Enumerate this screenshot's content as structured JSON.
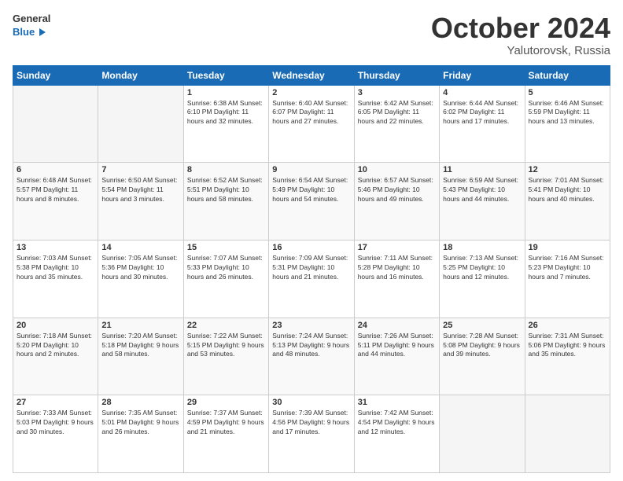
{
  "header": {
    "logo_line1": "General",
    "logo_line2": "Blue",
    "month": "October 2024",
    "location": "Yalutorovsk, Russia"
  },
  "weekdays": [
    "Sunday",
    "Monday",
    "Tuesday",
    "Wednesday",
    "Thursday",
    "Friday",
    "Saturday"
  ],
  "weeks": [
    [
      {
        "day": "",
        "info": ""
      },
      {
        "day": "",
        "info": ""
      },
      {
        "day": "1",
        "info": "Sunrise: 6:38 AM\nSunset: 6:10 PM\nDaylight: 11 hours\nand 32 minutes."
      },
      {
        "day": "2",
        "info": "Sunrise: 6:40 AM\nSunset: 6:07 PM\nDaylight: 11 hours\nand 27 minutes."
      },
      {
        "day": "3",
        "info": "Sunrise: 6:42 AM\nSunset: 6:05 PM\nDaylight: 11 hours\nand 22 minutes."
      },
      {
        "day": "4",
        "info": "Sunrise: 6:44 AM\nSunset: 6:02 PM\nDaylight: 11 hours\nand 17 minutes."
      },
      {
        "day": "5",
        "info": "Sunrise: 6:46 AM\nSunset: 5:59 PM\nDaylight: 11 hours\nand 13 minutes."
      }
    ],
    [
      {
        "day": "6",
        "info": "Sunrise: 6:48 AM\nSunset: 5:57 PM\nDaylight: 11 hours\nand 8 minutes."
      },
      {
        "day": "7",
        "info": "Sunrise: 6:50 AM\nSunset: 5:54 PM\nDaylight: 11 hours\nand 3 minutes."
      },
      {
        "day": "8",
        "info": "Sunrise: 6:52 AM\nSunset: 5:51 PM\nDaylight: 10 hours\nand 58 minutes."
      },
      {
        "day": "9",
        "info": "Sunrise: 6:54 AM\nSunset: 5:49 PM\nDaylight: 10 hours\nand 54 minutes."
      },
      {
        "day": "10",
        "info": "Sunrise: 6:57 AM\nSunset: 5:46 PM\nDaylight: 10 hours\nand 49 minutes."
      },
      {
        "day": "11",
        "info": "Sunrise: 6:59 AM\nSunset: 5:43 PM\nDaylight: 10 hours\nand 44 minutes."
      },
      {
        "day": "12",
        "info": "Sunrise: 7:01 AM\nSunset: 5:41 PM\nDaylight: 10 hours\nand 40 minutes."
      }
    ],
    [
      {
        "day": "13",
        "info": "Sunrise: 7:03 AM\nSunset: 5:38 PM\nDaylight: 10 hours\nand 35 minutes."
      },
      {
        "day": "14",
        "info": "Sunrise: 7:05 AM\nSunset: 5:36 PM\nDaylight: 10 hours\nand 30 minutes."
      },
      {
        "day": "15",
        "info": "Sunrise: 7:07 AM\nSunset: 5:33 PM\nDaylight: 10 hours\nand 26 minutes."
      },
      {
        "day": "16",
        "info": "Sunrise: 7:09 AM\nSunset: 5:31 PM\nDaylight: 10 hours\nand 21 minutes."
      },
      {
        "day": "17",
        "info": "Sunrise: 7:11 AM\nSunset: 5:28 PM\nDaylight: 10 hours\nand 16 minutes."
      },
      {
        "day": "18",
        "info": "Sunrise: 7:13 AM\nSunset: 5:25 PM\nDaylight: 10 hours\nand 12 minutes."
      },
      {
        "day": "19",
        "info": "Sunrise: 7:16 AM\nSunset: 5:23 PM\nDaylight: 10 hours\nand 7 minutes."
      }
    ],
    [
      {
        "day": "20",
        "info": "Sunrise: 7:18 AM\nSunset: 5:20 PM\nDaylight: 10 hours\nand 2 minutes."
      },
      {
        "day": "21",
        "info": "Sunrise: 7:20 AM\nSunset: 5:18 PM\nDaylight: 9 hours\nand 58 minutes."
      },
      {
        "day": "22",
        "info": "Sunrise: 7:22 AM\nSunset: 5:15 PM\nDaylight: 9 hours\nand 53 minutes."
      },
      {
        "day": "23",
        "info": "Sunrise: 7:24 AM\nSunset: 5:13 PM\nDaylight: 9 hours\nand 48 minutes."
      },
      {
        "day": "24",
        "info": "Sunrise: 7:26 AM\nSunset: 5:11 PM\nDaylight: 9 hours\nand 44 minutes."
      },
      {
        "day": "25",
        "info": "Sunrise: 7:28 AM\nSunset: 5:08 PM\nDaylight: 9 hours\nand 39 minutes."
      },
      {
        "day": "26",
        "info": "Sunrise: 7:31 AM\nSunset: 5:06 PM\nDaylight: 9 hours\nand 35 minutes."
      }
    ],
    [
      {
        "day": "27",
        "info": "Sunrise: 7:33 AM\nSunset: 5:03 PM\nDaylight: 9 hours\nand 30 minutes."
      },
      {
        "day": "28",
        "info": "Sunrise: 7:35 AM\nSunset: 5:01 PM\nDaylight: 9 hours\nand 26 minutes."
      },
      {
        "day": "29",
        "info": "Sunrise: 7:37 AM\nSunset: 4:59 PM\nDaylight: 9 hours\nand 21 minutes."
      },
      {
        "day": "30",
        "info": "Sunrise: 7:39 AM\nSunset: 4:56 PM\nDaylight: 9 hours\nand 17 minutes."
      },
      {
        "day": "31",
        "info": "Sunrise: 7:42 AM\nSunset: 4:54 PM\nDaylight: 9 hours\nand 12 minutes."
      },
      {
        "day": "",
        "info": ""
      },
      {
        "day": "",
        "info": ""
      }
    ]
  ]
}
